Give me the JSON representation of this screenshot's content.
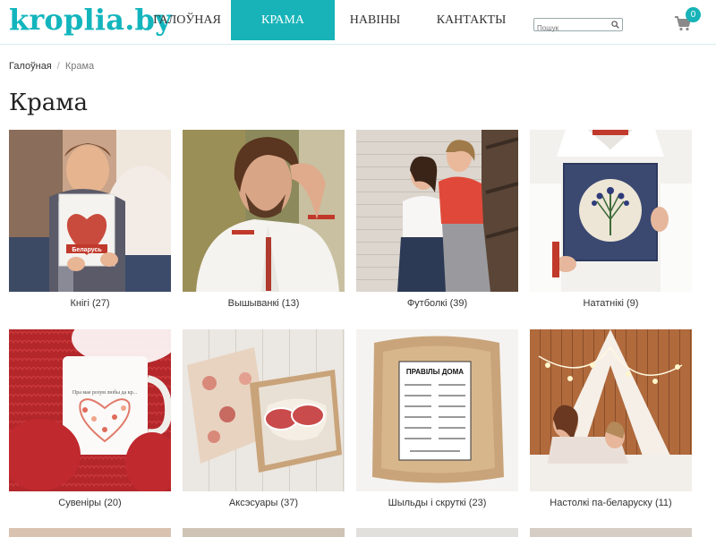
{
  "header": {
    "logo": "kroplia.by",
    "nav": [
      {
        "label": "ГАЛОЎНАЯ"
      },
      {
        "label": "КРАМА"
      },
      {
        "label": "НАВІНЫ"
      },
      {
        "label": "КАНТАКТЫ"
      }
    ],
    "search_placeholder": "Пошук",
    "cart_count": "0"
  },
  "breadcrumb": {
    "home": "Галоўная",
    "separator": "/",
    "current": "Крама"
  },
  "page_title": "Крама",
  "categories": [
    {
      "label": "Кнігі (27)",
      "book_title": "Беларусь"
    },
    {
      "label": "Вышыванкі (13)"
    },
    {
      "label": "Футболкі (39)"
    },
    {
      "label": "Нататнікі (9)"
    },
    {
      "label": "Сувеніры (20)",
      "mug_text": "Пра мае розум любы да кр..."
    },
    {
      "label": "Аксэсуары (37)"
    },
    {
      "label": "Шыльды і скруткі (23)",
      "sign_title": "ПРАВІЛЫ ДОМА"
    },
    {
      "label": "Настолкі па-беларуску (11)"
    }
  ],
  "colors": {
    "accent": "#17b3b8"
  }
}
